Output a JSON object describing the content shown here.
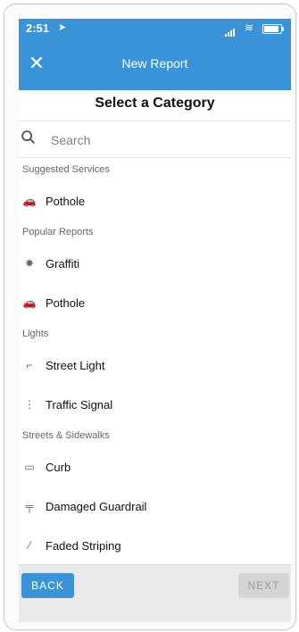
{
  "status": {
    "time": "2:51",
    "signal_icon": "signal-bars-icon",
    "wifi_icon": "wifi-icon",
    "battery_icon": "battery-icon"
  },
  "nav": {
    "title": "New Report",
    "close_icon": "close-icon"
  },
  "header": {
    "title": "Select a Category"
  },
  "search": {
    "placeholder": "Search",
    "icon": "search-icon"
  },
  "sections": [
    {
      "title": "Suggested Services",
      "items": [
        {
          "label": "Pothole",
          "icon": "car-icon"
        }
      ]
    },
    {
      "title": "Popular Reports",
      "items": [
        {
          "label": "Graffiti",
          "icon": "spray-can-icon"
        },
        {
          "label": "Pothole",
          "icon": "car-icon"
        }
      ]
    },
    {
      "title": "Lights",
      "items": [
        {
          "label": "Street Light",
          "icon": "street-light-icon"
        },
        {
          "label": "Traffic Signal",
          "icon": "traffic-signal-icon"
        }
      ]
    },
    {
      "title": "Streets & Sidewalks",
      "items": [
        {
          "label": "Curb",
          "icon": "curb-icon"
        },
        {
          "label": "Damaged Guardrail",
          "icon": "guardrail-icon"
        },
        {
          "label": "Faded Striping",
          "icon": "striping-icon"
        }
      ]
    }
  ],
  "footer": {
    "back_label": "BACK",
    "next_label": "NEXT"
  },
  "colors": {
    "primary": "#3a93d6",
    "disabled": "#d4d4d4"
  }
}
